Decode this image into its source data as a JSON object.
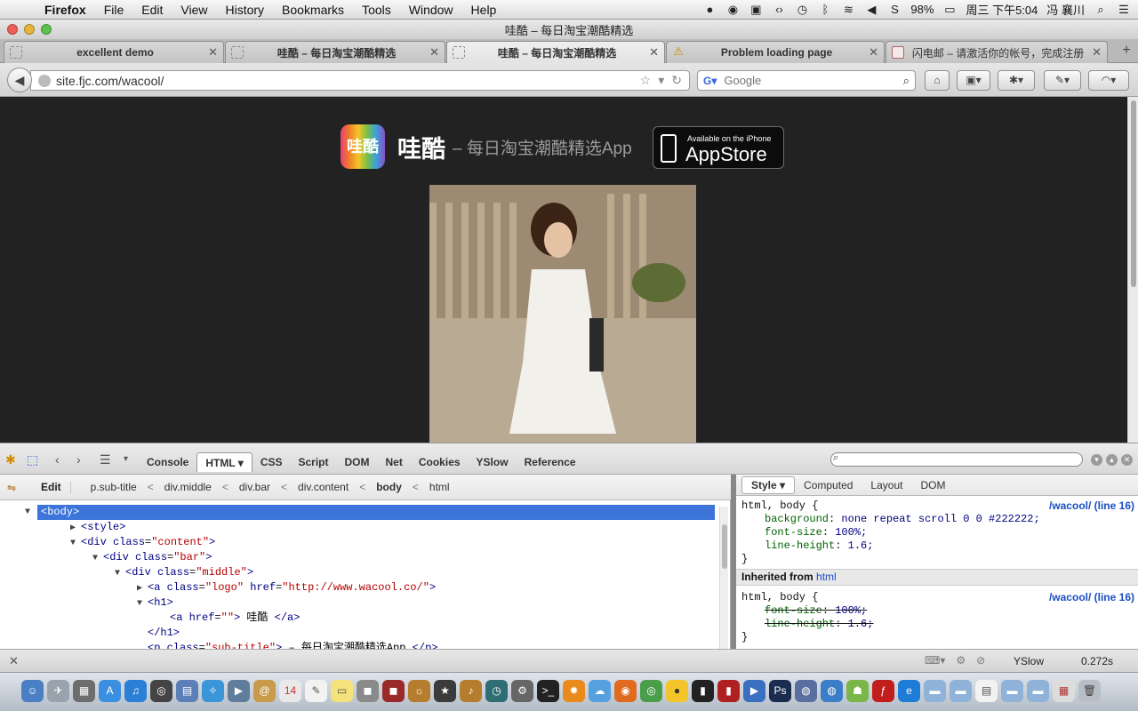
{
  "menubar": {
    "app": "Firefox",
    "items": [
      "File",
      "Edit",
      "View",
      "History",
      "Bookmarks",
      "Tools",
      "Window",
      "Help"
    ],
    "battery": "98%",
    "clock": "周三 下午5:04",
    "user": "冯 襄川"
  },
  "window": {
    "title": "哇酷 – 每日淘宝潮酷精选"
  },
  "tabs": [
    {
      "label": "excellent demo",
      "icon": "blank-page-icon"
    },
    {
      "label": "哇酷 – 每日淘宝潮酷精选",
      "icon": "blank-page-icon"
    },
    {
      "label": "哇酷 – 每日淘宝潮酷精选",
      "icon": "blank-page-icon",
      "active": true
    },
    {
      "label": "Problem loading page",
      "icon": "warning-icon"
    },
    {
      "label": "闪电邮 – 请激活你的帐号，完成注册",
      "icon": "mail-icon"
    }
  ],
  "navbar": {
    "url": "site.fjc.com/wacool/",
    "search_engine": "Google",
    "search_placeholder": "Google"
  },
  "page": {
    "app_icon_text": "哇酷",
    "brand_title": "哇酷",
    "brand_subtitle": "– 每日淘宝潮酷精选App",
    "appstore_small": "Available on the iPhone",
    "appstore_big": "AppStore",
    "background": "#222222"
  },
  "firebug": {
    "tabs": [
      "Console",
      "HTML",
      "CSS",
      "Script",
      "DOM",
      "Net",
      "Cookies",
      "YSlow",
      "Reference"
    ],
    "active_tab": "HTML",
    "edit_label": "Edit",
    "breadcrumbs": [
      "p.sub-title",
      "div.middle",
      "div.bar",
      "div.content",
      "body",
      "html"
    ],
    "tree": [
      {
        "indent": 0,
        "toggle": "▼",
        "tag": "<body>",
        "selected": true
      },
      {
        "indent": 1,
        "toggle": "▶",
        "tag": "<style>"
      },
      {
        "indent": 1,
        "toggle": "▼",
        "tag": "<div",
        "attr": "class",
        "val": "\"content\"",
        "close": ">"
      },
      {
        "indent": 2,
        "toggle": "▼",
        "tag": "<div",
        "attr": "class",
        "val": "\"bar\"",
        "close": ">"
      },
      {
        "indent": 3,
        "toggle": "▼",
        "tag": "<div",
        "attr": "class",
        "val": "\"middle\"",
        "close": ">"
      },
      {
        "indent": 4,
        "toggle": "▶",
        "tag": "<a",
        "attr": "class",
        "val": "\"logo\"",
        "attr2": "href",
        "val2": "\"http://www.wacool.co/\"",
        "close": ">"
      },
      {
        "indent": 4,
        "toggle": "▼",
        "tag": "<h1>"
      },
      {
        "indent": 5,
        "toggle": "",
        "tag": "<a",
        "attr": "href",
        "val": "\"\"",
        "close": ">",
        "text": " 哇酷 ",
        "end": "</a>"
      },
      {
        "indent": 4,
        "toggle": "",
        "tag": "</h1>"
      },
      {
        "indent": 4,
        "toggle": "",
        "tag": "<p",
        "attr": "class",
        "val": "\"sub-title\"",
        "close": ">",
        "text": " – 每日淘宝潮酷精选App ",
        "end": "</p>"
      }
    ],
    "side_tabs": [
      "Style",
      "Computed",
      "Layout",
      "DOM"
    ],
    "side_active": "Style",
    "rule1": {
      "selector": "html, body {",
      "source": "/wacool/ (line 16)",
      "props": [
        {
          "name": "background",
          "value": "none repeat scroll 0 0 #222222;"
        },
        {
          "name": "font-size",
          "value": "100%;"
        },
        {
          "name": "line-height",
          "value": "1.6;"
        }
      ],
      "close": "}"
    },
    "inherited_label": "Inherited from",
    "inherited_el": "html",
    "rule2": {
      "selector": "html, body {",
      "source": "/wacool/ (line 16)",
      "props": [
        {
          "name": "font-size",
          "value": "100%;",
          "overridden": true
        },
        {
          "name": "line-height",
          "value": "1.6;",
          "overridden": true
        }
      ],
      "close": "}"
    },
    "status_yslow": "YSlow",
    "status_time": "0.272s"
  }
}
